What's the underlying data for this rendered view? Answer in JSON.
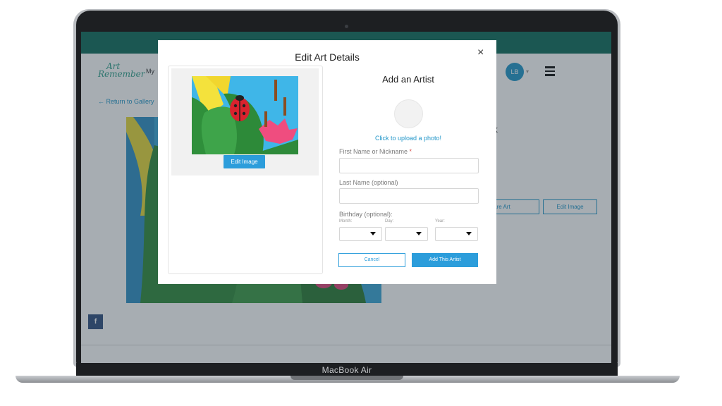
{
  "device": {
    "label": "MacBook Air"
  },
  "app": {
    "logo": {
      "line1": "Art",
      "line2": "Remember"
    },
    "nav_partial": "My",
    "user": {
      "initials": "LB"
    },
    "back_link": "Return to Gallery",
    "art_title_partial": "rk",
    "buttons": {
      "share": "Share Art",
      "edit_image": "Edit Image"
    },
    "social": {
      "facebook": "f"
    }
  },
  "modal": {
    "title": "Edit Art Details",
    "close": "×",
    "edit_image_button": "Edit Image",
    "add_artist": {
      "heading": "Add an Artist",
      "upload_link": "Click to upload a photo!",
      "first_name_label": "First Name or Nickname",
      "required_marker": "*",
      "first_name_value": "",
      "last_name_label": "Last Name (optional)",
      "last_name_value": "",
      "birthday_label": "Birthday (optional):",
      "month_label": "Month:",
      "day_label": "Day:",
      "year_label": "Year:",
      "month_value": "",
      "day_value": "",
      "year_value": "",
      "cancel_button": "Cancel",
      "add_button": "Add This Artist"
    }
  },
  "colors": {
    "accent": "#2c9ddb",
    "topbar": "#0f6b5b",
    "required": "#d9534f"
  }
}
